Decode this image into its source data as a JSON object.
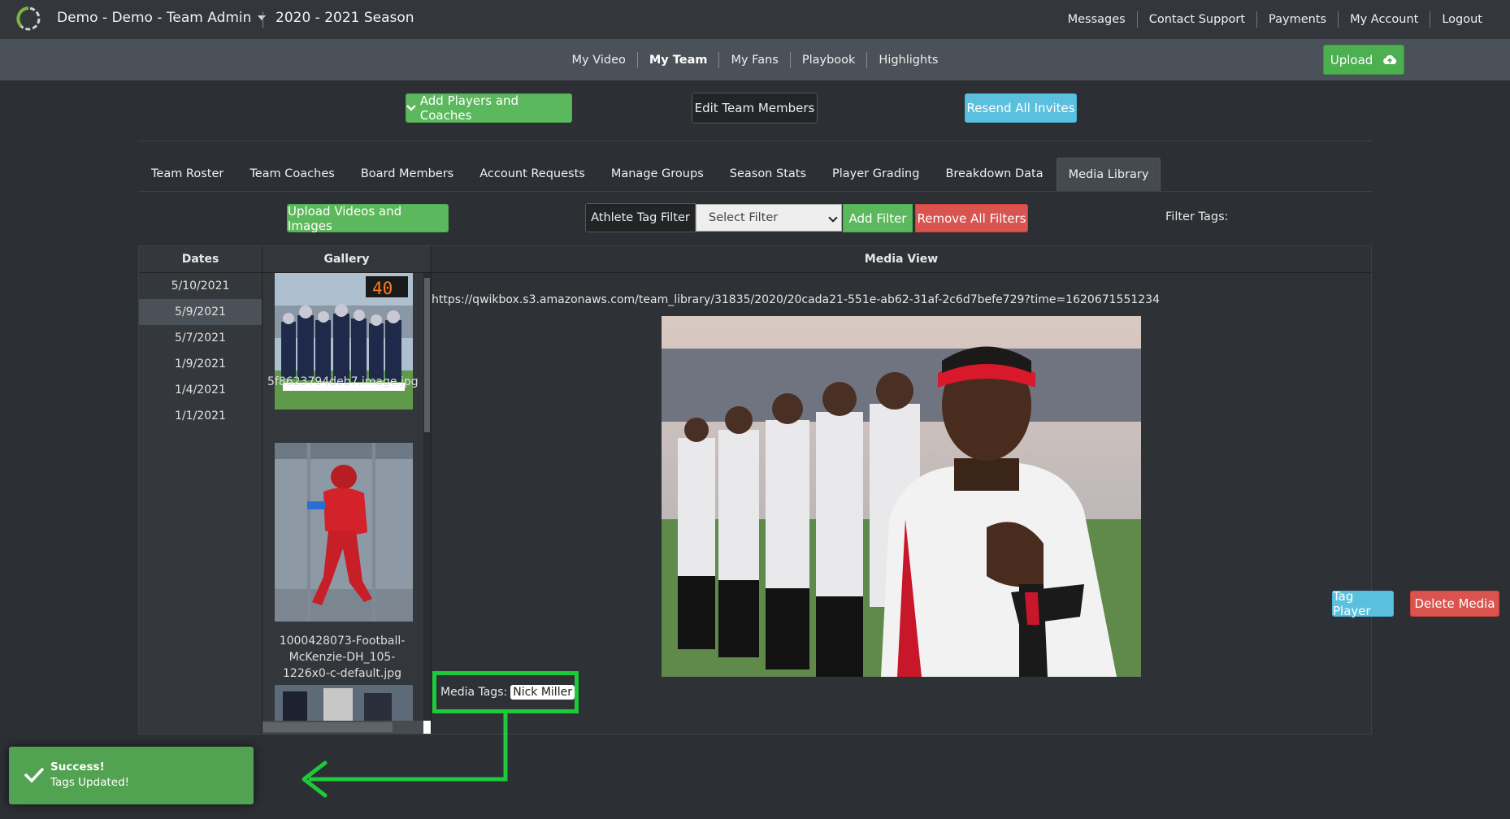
{
  "header": {
    "brand": "Demo - Demo - Team Admin",
    "season": "2020 - 2021 Season",
    "nav": [
      "Messages",
      "Contact Support",
      "Payments",
      "My Account",
      "Logout"
    ]
  },
  "subnav": {
    "items": [
      "My Video",
      "My Team",
      "My Fans",
      "Playbook",
      "Highlights"
    ],
    "active": "My Team",
    "upload_label": "Upload"
  },
  "actions": {
    "add_players": "Add Players and Coaches",
    "edit_members": "Edit Team Members",
    "resend_invites": "Resend All Invites"
  },
  "tabs": {
    "items": [
      "Team Roster",
      "Team Coaches",
      "Board Members",
      "Account Requests",
      "Manage Groups",
      "Season Stats",
      "Player Grading",
      "Breakdown Data",
      "Media Library"
    ],
    "active": "Media Library"
  },
  "toolbar": {
    "upload_media": "Upload Videos and Images",
    "filter_label": "Athlete Tag Filter",
    "filter_select_value": "Select Filter",
    "add_filter": "Add Filter",
    "remove_filters": "Remove All Filters",
    "filter_tags_label": "Filter Tags:"
  },
  "library": {
    "dates_header": "Dates",
    "gallery_header": "Gallery",
    "media_header": "Media View",
    "dates": [
      "5/10/2021",
      "5/9/2021",
      "5/7/2021",
      "1/9/2021",
      "1/4/2021",
      "1/1/2021"
    ],
    "selected_date": "5/9/2021",
    "gallery_captions": [
      "5f8623794deb7.image.jpg",
      "1000428073-Football-McKenzie-DH_105-1226x0-c-default.jpg"
    ],
    "scoreboard_text": "40",
    "media_url": "https://qwikbox.s3.amazonaws.com/team_library/31835/2020/20cada21-551e-ab62-31af-2c6d7befe729?time=1620671551234",
    "tags_label": "Media Tags:",
    "tags": [
      "Nick Miller"
    ],
    "tag_player": "Tag Player",
    "delete_media": "Delete Media"
  },
  "toast": {
    "title": "Success!",
    "message": "Tags Updated!"
  },
  "colors": {
    "accent_green": "#5cb85c",
    "info_blue": "#5bc0de",
    "danger_red": "#d9534f",
    "highlight_green": "#1ec93a"
  }
}
